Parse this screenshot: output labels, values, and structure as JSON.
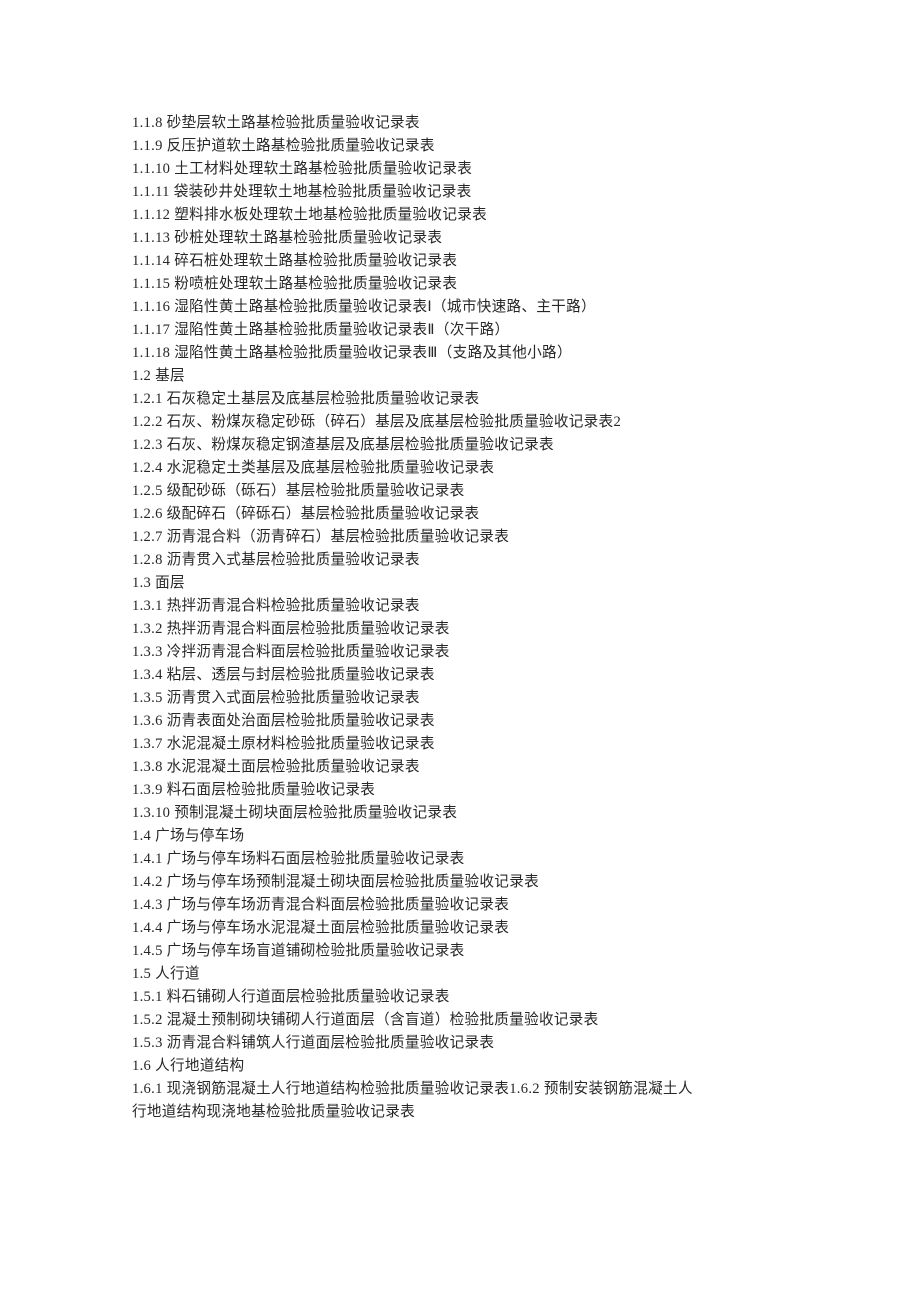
{
  "lines": [
    "1.1.8 砂垫层软土路基检验批质量验收记录表",
    "1.1.9 反压护道软土路基检验批质量验收记录表",
    "1.1.10 土工材料处理软土路基检验批质量验收记录表",
    "1.1.11 袋装砂井处理软土地基检验批质量验收记录表",
    "1.1.12 塑料排水板处理软土地基检验批质量验收记录表",
    "1.1.13 砂桩处理软土路基检验批质量验收记录表",
    "1.1.14 碎石桩处理软土路基检验批质量验收记录表",
    "1.1.15 粉喷桩处理软土路基检验批质量验收记录表",
    "1.1.16 湿陷性黄土路基检验批质量验收记录表Ⅰ（城市快速路、主干路）",
    "1.1.17 湿陷性黄土路基检验批质量验收记录表Ⅱ（次干路）",
    "1.1.18 湿陷性黄土路基检验批质量验收记录表Ⅲ（支路及其他小路）",
    "1.2 基层",
    "1.2.1 石灰稳定土基层及底基层检验批质量验收记录表",
    "1.2.2 石灰、粉煤灰稳定砂砾（碎石）基层及底基层检验批质量验收记录表2",
    "1.2.3 石灰、粉煤灰稳定钢渣基层及底基层检验批质量验收记录表",
    "1.2.4 水泥稳定土类基层及底基层检验批质量验收记录表",
    "1.2.5 级配砂砾（砾石）基层检验批质量验收记录表",
    "1.2.6 级配碎石（碎砾石）基层检验批质量验收记录表",
    "1.2.7 沥青混合料（沥青碎石）基层检验批质量验收记录表",
    "1.2.8 沥青贯入式基层检验批质量验收记录表",
    "1.3 面层",
    "1.3.1 热拌沥青混合料检验批质量验收记录表",
    "1.3.2 热拌沥青混合料面层检验批质量验收记录表",
    "1.3.3 冷拌沥青混合料面层检验批质量验收记录表",
    "1.3.4 粘层、透层与封层检验批质量验收记录表",
    "1.3.5 沥青贯入式面层检验批质量验收记录表",
    "1.3.6 沥青表面处治面层检验批质量验收记录表",
    "1.3.7 水泥混凝土原材料检验批质量验收记录表",
    "1.3.8 水泥混凝土面层检验批质量验收记录表",
    "1.3.9 料石面层检验批质量验收记录表",
    "1.3.10 预制混凝土砌块面层检验批质量验收记录表",
    "1.4 广场与停车场",
    "1.4.1 广场与停车场料石面层检验批质量验收记录表",
    "1.4.2 广场与停车场预制混凝土砌块面层检验批质量验收记录表",
    "1.4.3 广场与停车场沥青混合料面层检验批质量验收记录表",
    "1.4.4 广场与停车场水泥混凝土面层检验批质量验收记录表",
    "1.4.5 广场与停车场盲道铺砌检验批质量验收记录表",
    "1.5 人行道",
    "1.5.1 料石铺砌人行道面层检验批质量验收记录表",
    "1.5.2 混凝土预制砌块铺砌人行道面层（含盲道）检验批质量验收记录表",
    "1.5.3 沥青混合料铺筑人行道面层检验批质量验收记录表",
    "1.6 人行地道结构",
    "1.6.1 现浇钢筋混凝土人行地道结构检验批质量验收记录表1.6.2 预制安装钢筋混凝土人",
    "行地道结构现浇地基检验批质量验收记录表"
  ]
}
